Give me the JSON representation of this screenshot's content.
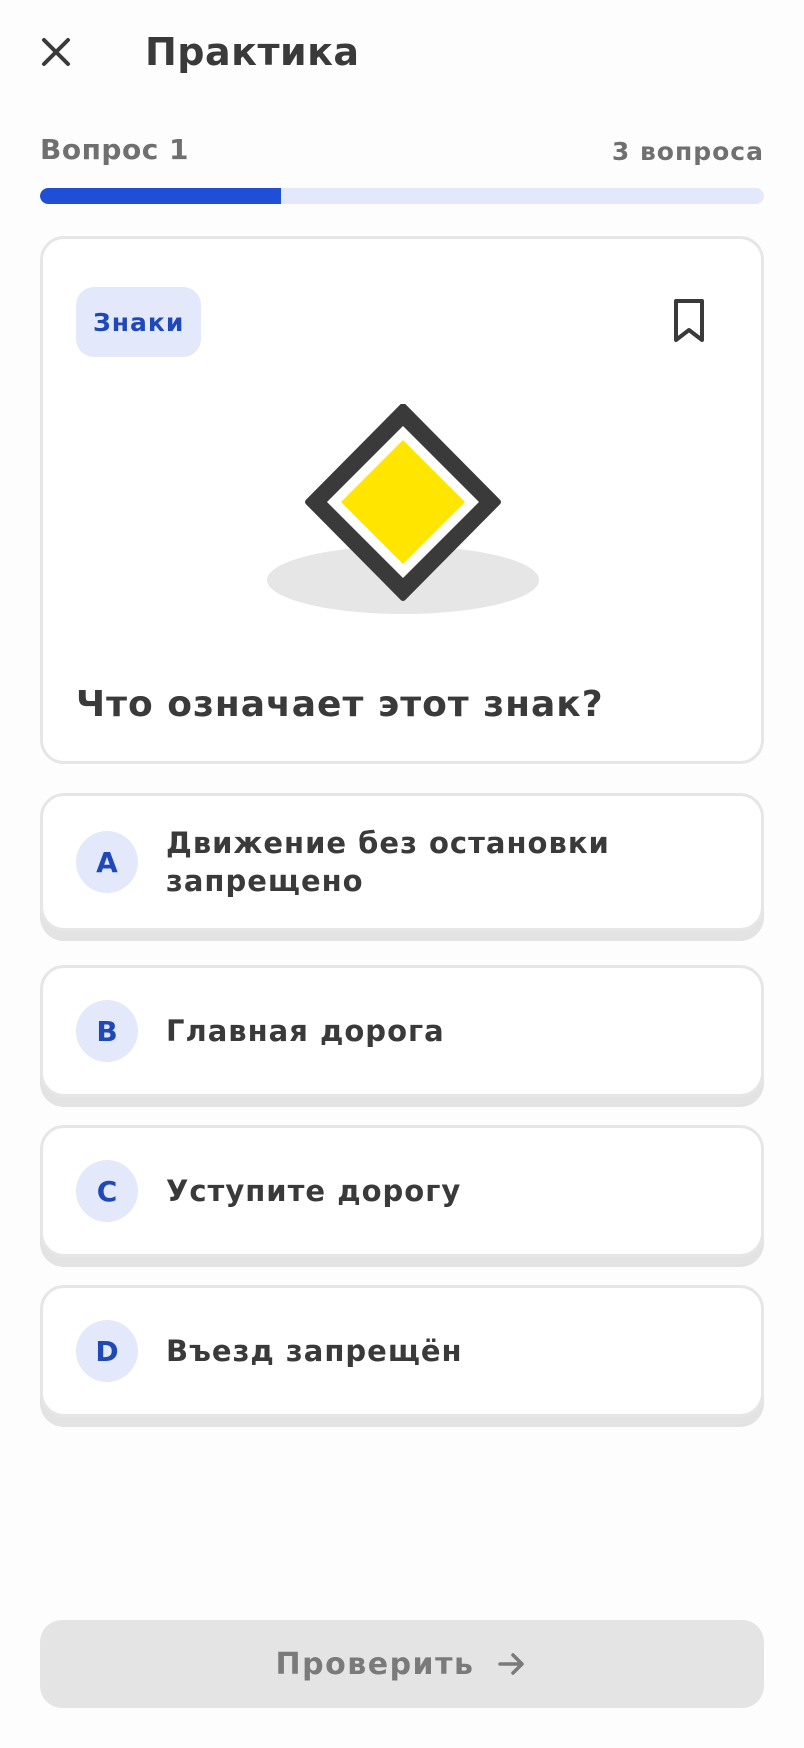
{
  "header": {
    "title": "Практика",
    "close_icon": "close-icon"
  },
  "progress": {
    "question_label": "Вопрос 1",
    "total_label": "3 вопроса",
    "fraction": 0.333
  },
  "question_card": {
    "category": "Знаки",
    "bookmark_icon": "bookmark-icon",
    "sign_image": "priority-road-sign",
    "question": "Что означает этот знак?"
  },
  "answers": [
    {
      "letter": "A",
      "text": "Движение без остановки запрещено"
    },
    {
      "letter": "B",
      "text": "Главная дорога"
    },
    {
      "letter": "C",
      "text": "Уступите дорогу"
    },
    {
      "letter": "D",
      "text": "Въезд запрещён"
    }
  ],
  "footer": {
    "check_label": "Проверить",
    "arrow_icon": "arrow-right-icon"
  },
  "colors": {
    "accent": "#1f4fd6",
    "accent_light": "#e3e9fa",
    "sign_yellow": "#ffe500",
    "sign_border": "#3a3a3a"
  }
}
